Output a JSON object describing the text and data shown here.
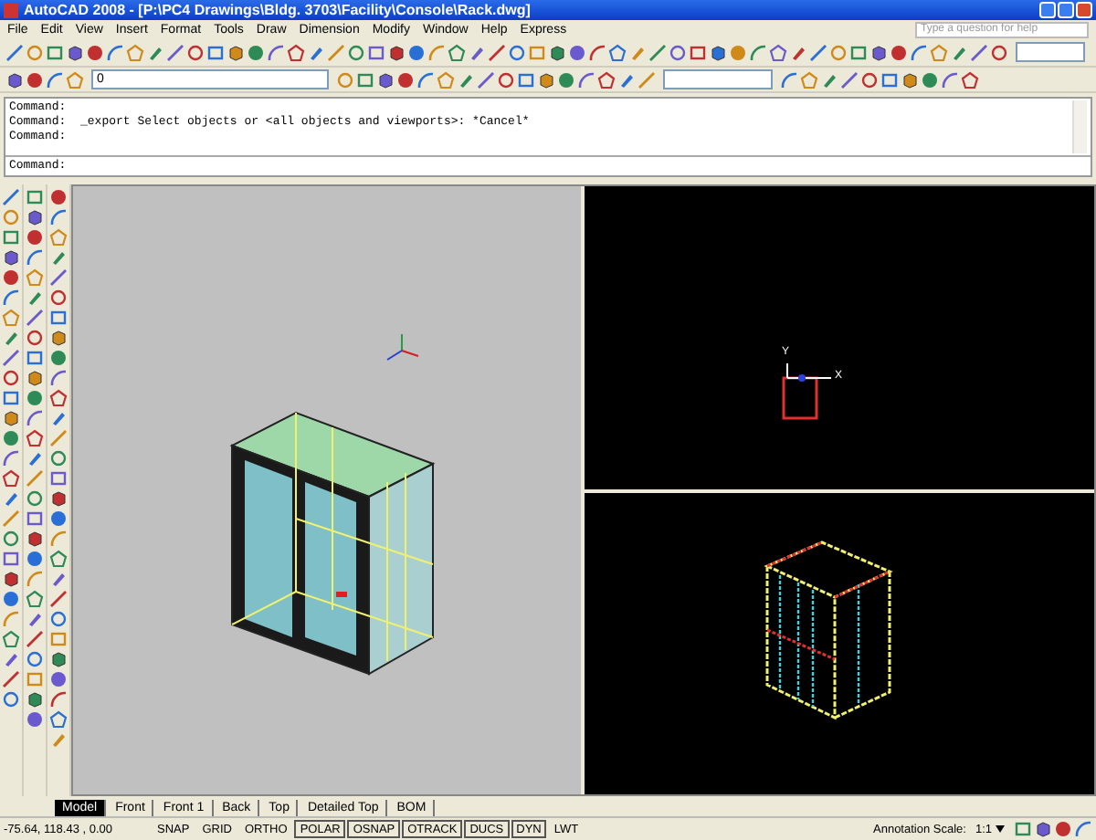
{
  "window": {
    "title": "AutoCAD 2008 - [P:\\PC4 Drawings\\Bldg. 3703\\Facility\\Console\\Rack.dwg]"
  },
  "menu": [
    "File",
    "Edit",
    "View",
    "Insert",
    "Format",
    "Tools",
    "Draw",
    "Dimension",
    "Modify",
    "Window",
    "Help",
    "Express"
  ],
  "help_search": {
    "placeholder": "Type a question for help"
  },
  "layer_dropdown": {
    "value": "0"
  },
  "command_history": [
    "Command:",
    "Command:  _export Select objects or <all objects and viewports>: *Cancel*",
    "Command:"
  ],
  "command_prompt": "Command:",
  "viewports": [
    {
      "kind": "iso"
    },
    {
      "kind": "top",
      "axis_labels": [
        "Y",
        "X"
      ]
    },
    {
      "kind": "wire"
    }
  ],
  "layout_tabs": [
    {
      "label": "Model",
      "selected": true
    },
    {
      "label": "Front",
      "selected": false
    },
    {
      "label": "Front 1",
      "selected": false
    },
    {
      "label": "Back",
      "selected": false
    },
    {
      "label": "Top",
      "selected": false
    },
    {
      "label": "Detailed Top",
      "selected": false
    },
    {
      "label": "BOM",
      "selected": false
    }
  ],
  "status_bar": {
    "coordinates": "-75.64, 118.43 , 0.00",
    "toggles": [
      {
        "label": "SNAP",
        "on": false
      },
      {
        "label": "GRID",
        "on": false
      },
      {
        "label": "ORTHO",
        "on": false
      },
      {
        "label": "POLAR",
        "on": true
      },
      {
        "label": "OSNAP",
        "on": true
      },
      {
        "label": "OTRACK",
        "on": true
      },
      {
        "label": "DUCS",
        "on": true
      },
      {
        "label": "DYN",
        "on": true
      },
      {
        "label": "LWT",
        "on": false
      }
    ],
    "annotation_label": "Annotation Scale:",
    "annotation_value": "1:1"
  }
}
